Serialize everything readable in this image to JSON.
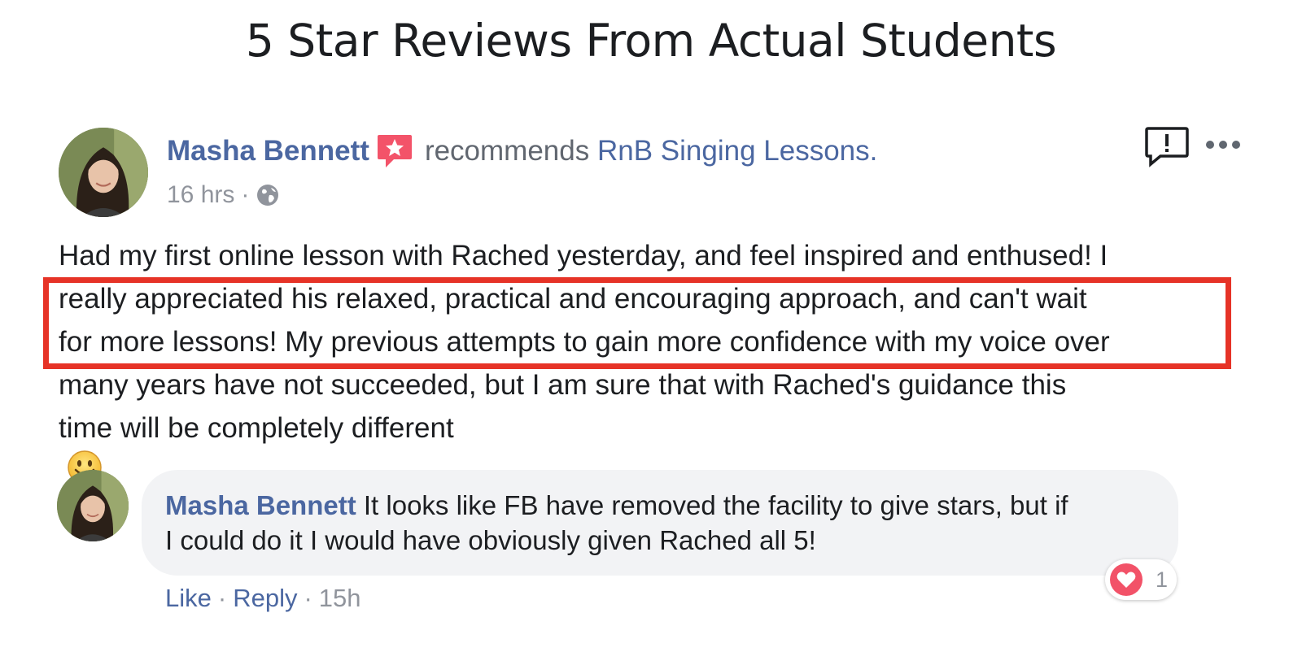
{
  "page": {
    "heading": "5 Star Reviews From Actual Students"
  },
  "post": {
    "author": "Masha Bennett",
    "recommends_text": "recommends",
    "page_name": "RnB Singing Lessons.",
    "timestamp": "16 hrs",
    "separator": "·",
    "body_lines": [
      "Had my first online lesson with Rached yesterday, and feel inspired and enthused! I",
      "really appreciated his relaxed, practical and encouraging approach, and can't wait",
      "for more lessons! My previous attempts to gain more confidence with my voice over",
      "many years have not succeeded, but I am sure that with Rached's guidance this",
      "time will be completely different"
    ],
    "highlighted_lines": [
      2,
      3
    ]
  },
  "comment": {
    "author": "Masha Bennett",
    "text_line1": "It looks like FB have removed the facility to give stars, but if",
    "text_line2": "I could do it I would have obviously given Rached all 5!",
    "reaction_count": "1",
    "like_label": "Like",
    "reply_label": "Reply",
    "time": "15h",
    "separator": "·"
  },
  "colors": {
    "link": "#4b67a1",
    "secondary_text": "#90949c",
    "highlight": "#e63327",
    "bubble": "#f2f3f5",
    "recommend_badge": "#f35369"
  }
}
